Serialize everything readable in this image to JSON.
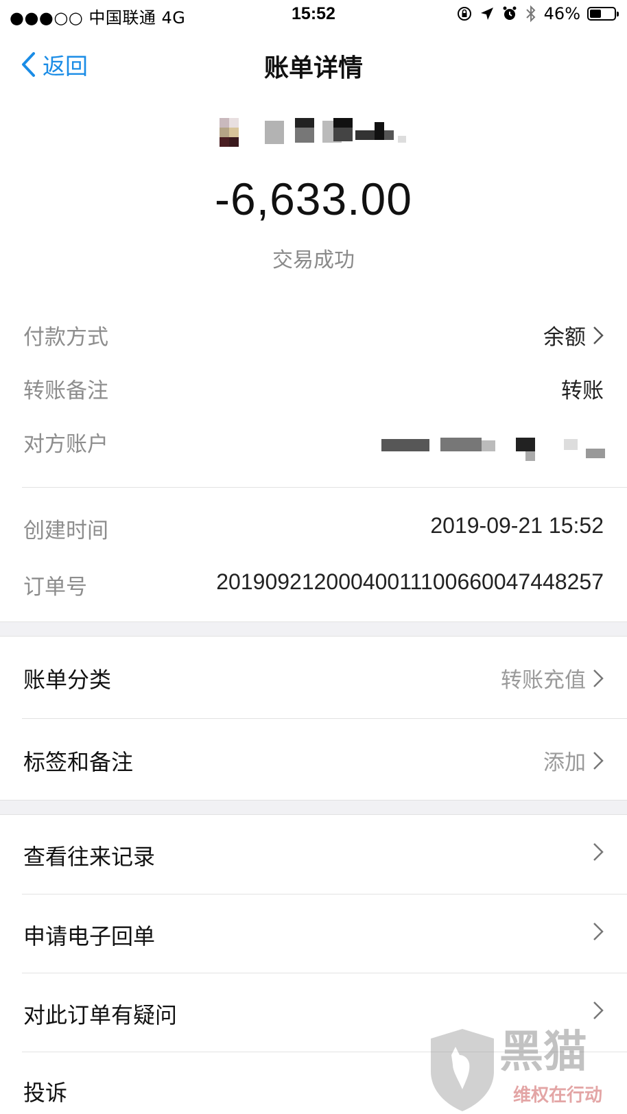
{
  "status_bar": {
    "carrier": "●●●○○ 中国联通  4G",
    "time": "15:52",
    "battery": "46%",
    "battery_level": 0.46
  },
  "nav": {
    "back_label": "返回",
    "title": "账单详情"
  },
  "header": {
    "amount": "-6,633.00",
    "status": "交易成功"
  },
  "details": {
    "pay_method_label": "付款方式",
    "pay_method_value": "余额",
    "note_label": "转账备注",
    "note_value": "转账",
    "counterparty_label": "对方账户",
    "created_label": "创建时间",
    "created_value": "2019-09-21 15:52",
    "order_label": "订单号",
    "order_value": "20190921200040011100660047448257"
  },
  "section2": {
    "category_label": "账单分类",
    "category_value": "转账充值",
    "tags_label": "标签和备注",
    "tags_value": "添加"
  },
  "section3": {
    "items": [
      {
        "label": "查看往来记录"
      },
      {
        "label": "申请电子回单"
      },
      {
        "label": "对此订单有疑问"
      },
      {
        "label": "投诉"
      }
    ]
  },
  "watermark": {
    "text": "黑猫",
    "sub": "维权在行动"
  },
  "colors": {
    "accent": "#1a8ce6",
    "label_gray": "#8d8d8d",
    "section_bg": "#f1f1f4"
  }
}
